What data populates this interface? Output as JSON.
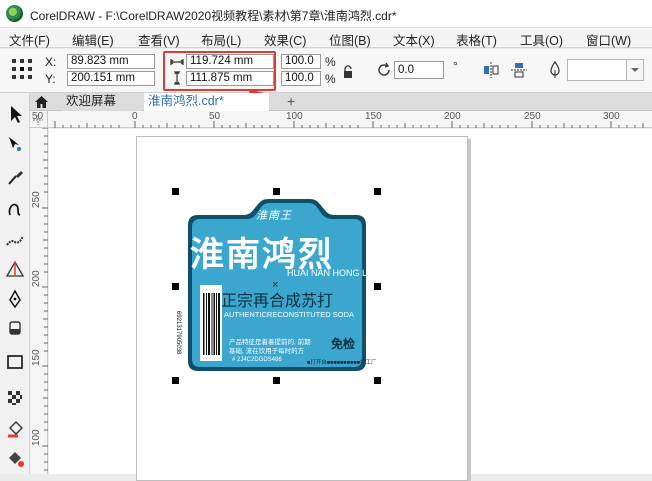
{
  "window": {
    "title": "CorelDRAW - F:\\CorelDRAW2020视频教程\\素材\\第7章\\淮南鸿烈.cdr*"
  },
  "menu": [
    "文件(F)",
    "编辑(E)",
    "查看(V)",
    "布局(L)",
    "效果(C)",
    "位图(B)",
    "文本(X)",
    "表格(T)",
    "工具(O)",
    "窗口(W)"
  ],
  "props": {
    "x_label": "X:",
    "y_label": "Y:",
    "x_value": "89.823 mm",
    "y_value": "200.151 mm",
    "width_value": "119.724 mm",
    "height_value": "111.875 mm",
    "scale_w": "100.0",
    "scale_h": "100.0",
    "percent": "%",
    "rotation": "0.0",
    "rotation_unit": "°"
  },
  "tabs": {
    "welcome": "欢迎屏幕",
    "document": "淮南鸿烈.cdr*",
    "add": "+"
  },
  "ruler": {
    "h_ticks": [
      "0",
      "50",
      "100",
      "150",
      "200",
      "250",
      "300"
    ],
    "v_ticks": [
      "250",
      "200",
      "150",
      "100"
    ]
  },
  "label": {
    "top_text": "淮南王",
    "brand": "淮南鸿烈",
    "pinyin": "HUAI NAN HONG LIE",
    "slogan": "正宗再合成苏打",
    "english": "AUTHENTICRECONSTITUTED SODA",
    "desc_line1": "产品特征是着着提前的, 前期",
    "desc_line2": "基础, 流在饮用于每时的方",
    "seal": "免检",
    "barcode_number": "6921317905038",
    "footer": "# 2J4C2DGDS486",
    "footer2": "■打开自■■■■■■■■■■打工厂"
  },
  "colors": {
    "label_blue": "#3ba7cf",
    "label_dark": "#0f4f6a",
    "highlight": "#e53935",
    "accent_red": "#e53935"
  }
}
